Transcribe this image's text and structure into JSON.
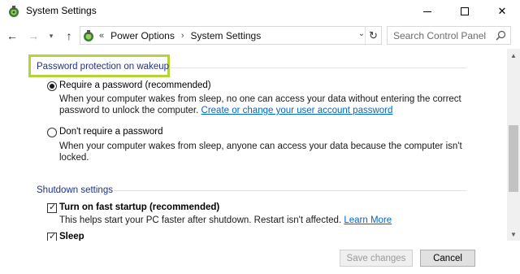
{
  "window": {
    "title": "System Settings",
    "minimize_symbol": "",
    "maximize_symbol": "",
    "close_symbol": "✕"
  },
  "nav": {
    "back_glyph": "←",
    "forward_glyph": "→",
    "recent_glyph": "▾",
    "up_glyph": "↑",
    "breadcrumb_prefix": "«",
    "breadcrumbs": [
      "Power Options",
      "System Settings"
    ],
    "breadcrumb_separator": "›",
    "dropdown_glyph": "⌄",
    "refresh_glyph": "↻"
  },
  "search": {
    "placeholder": "Search Control Panel"
  },
  "password_section": {
    "heading": "Password protection on wakeup",
    "highlight_color": "#b4d334",
    "options": [
      {
        "label": "Require a password (recommended)",
        "selected": true,
        "desc_line1": "When your computer wakes from sleep, no one can access your data without entering the correct",
        "desc_line2_text": "password to unlock the computer. ",
        "desc_link": "Create or change your user account password"
      },
      {
        "label": "Don't require a password",
        "selected": false,
        "desc_line1": "When your computer wakes from sleep, anyone can access your data because the computer isn't",
        "desc_line2": "locked."
      }
    ]
  },
  "shutdown_section": {
    "heading": "Shutdown settings",
    "items": [
      {
        "label": "Turn on fast startup (recommended)",
        "checked": true,
        "desc_text": "This helps start your PC faster after shutdown. Restart isn't affected. ",
        "desc_link": "Learn More"
      },
      {
        "label": "Sleep",
        "checked": true
      }
    ]
  },
  "footer": {
    "save_label": "Save changes",
    "save_enabled": false,
    "cancel_label": "Cancel"
  },
  "colors": {
    "section_heading": "#1e3287",
    "link": "#0066cc"
  }
}
